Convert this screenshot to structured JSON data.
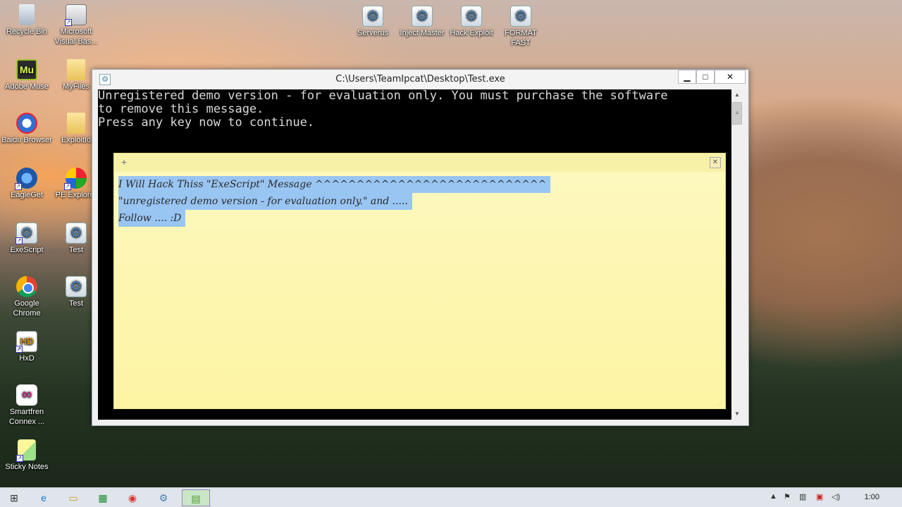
{
  "desktop": {
    "icons_left": [
      {
        "label": "Recycle Bin",
        "icon": "recycle-bin-icon"
      },
      {
        "label": "Microsoft Visual Bas...",
        "icon": "visual-basic-icon"
      },
      {
        "label": "Adobe Muse",
        "icon": "adobe-muse-icon"
      },
      {
        "label": "MyFiles",
        "icon": "folder-icon"
      },
      {
        "label": "Baidu Browser",
        "icon": "baidu-browser-icon"
      },
      {
        "label": "ExploitId",
        "icon": "folder-icon"
      },
      {
        "label": "EagleGet",
        "icon": "eagleget-icon"
      },
      {
        "label": "PE Explorer",
        "icon": "pe-explorer-icon"
      },
      {
        "label": "ExeScript",
        "icon": "exescript-icon"
      },
      {
        "label": "Test",
        "icon": "script-gear-icon"
      },
      {
        "label": "Google Chrome",
        "icon": "chrome-icon"
      },
      {
        "label": "Test",
        "icon": "script-gear-icon"
      },
      {
        "label": "HxD",
        "icon": "hxd-icon"
      },
      {
        "label": "Smartfren Connex ...",
        "icon": "smartfren-icon"
      },
      {
        "label": "Sticky Notes",
        "icon": "sticky-notes-icon"
      }
    ],
    "icons_top": [
      {
        "label": "Serverus",
        "icon": "script-gear-icon"
      },
      {
        "label": "Inject Master",
        "icon": "script-gear-icon"
      },
      {
        "label": "Hack Exploit",
        "icon": "script-gear-icon"
      },
      {
        "label": "FORMAT FAST",
        "icon": "script-gear-icon"
      }
    ]
  },
  "console": {
    "title": "C:\\Users\\TeamIpcat\\Desktop\\Test.exe",
    "lines": [
      "Unregistered demo version - for evaluation only. You must purchase the software",
      "to remove this message.",
      "Press any key now to continue."
    ],
    "minimize_glyph": "▁",
    "maximize_glyph": "□",
    "close_glyph": "✕"
  },
  "sticky_note": {
    "add_glyph": "+",
    "close_glyph": "✕",
    "lines": [
      "I Will Hack Thiss \"ExeScript\" Message ^^^^^^^^^^^^^^^^^^^^^^^^^^^^",
      "\"unregistered demo version - for evaluation only.\" and .....",
      "Follow .... :D"
    ]
  },
  "taskbar": {
    "clock": "1:00",
    "buttons": [
      "start-icon",
      "ie-icon",
      "explorer-icon",
      "excel-icon",
      "chrome-icon",
      "script-gear-icon",
      "sticky-notes-icon"
    ]
  }
}
